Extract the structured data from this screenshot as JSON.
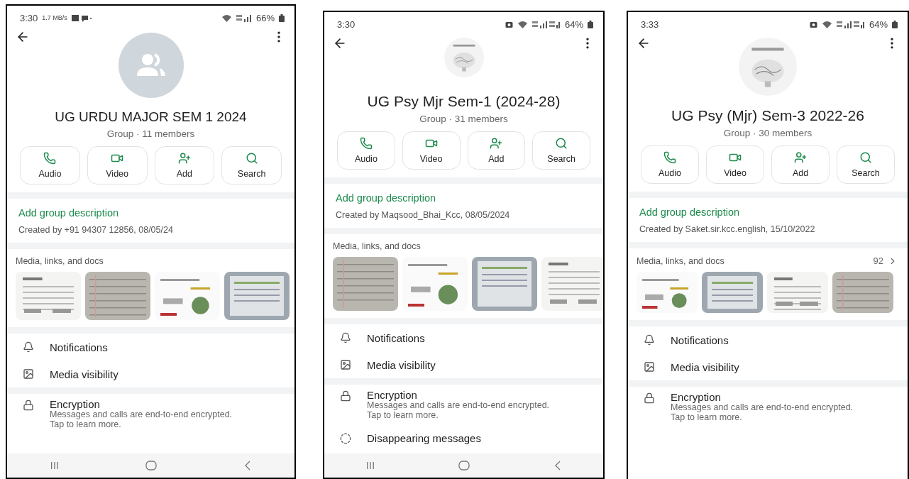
{
  "phones": [
    {
      "status_bar": {
        "time": "3:30",
        "net_speed": "1.7 MB/s",
        "battery": "66%"
      },
      "avatar": {
        "kind": "group-icon"
      },
      "name": "UG URDU MAJOR SEM 1 2024",
      "subtitle": "Group · 11 members",
      "actions": [
        {
          "kind": "audio",
          "label": "Audio"
        },
        {
          "kind": "video",
          "label": "Video"
        },
        {
          "kind": "add",
          "label": "Add"
        },
        {
          "kind": "search",
          "label": "Search"
        }
      ],
      "description_link": "Add group description",
      "created": "Created by +91 94307 12856, 08/05/24",
      "media": {
        "title": "Media, links, and docs",
        "thumbnails": [
          {
            "kind": "picture"
          },
          {
            "kind": "picture"
          },
          {
            "kind": "picture"
          },
          {
            "kind": "picture"
          }
        ]
      },
      "settings": [
        {
          "kind": "notifications",
          "title": "Notifications"
        },
        {
          "kind": "media",
          "title": "Media visibility"
        },
        {
          "kind": "encryption",
          "title": "Encryption",
          "subtitle": "Messages and calls are end-to-end encrypted. Tap to learn more."
        }
      ],
      "nav_bar": true
    },
    {
      "status_bar": {
        "time": "3:30",
        "battery": "64%"
      },
      "avatar": {
        "kind": "picture"
      },
      "name": "UG Psy Mjr Sem-1 (2024-28)",
      "subtitle": "Group · 31 members",
      "actions": [
        {
          "kind": "audio",
          "label": "Audio"
        },
        {
          "kind": "video",
          "label": "Video"
        },
        {
          "kind": "add",
          "label": "Add"
        },
        {
          "kind": "search",
          "label": "Search"
        }
      ],
      "description_link": "Add group description",
      "created": "Created by Maqsood_Bhai_Kcc, 08/05/2024",
      "media": {
        "title": "Media, links, and docs",
        "thumbnails": [
          {
            "kind": "picture"
          },
          {
            "kind": "picture"
          },
          {
            "kind": "picture"
          },
          {
            "kind": "picture"
          }
        ]
      },
      "settings": [
        {
          "kind": "notifications",
          "title": "Notifications"
        },
        {
          "kind": "media",
          "title": "Media visibility"
        },
        {
          "kind": "encryption",
          "title": "Encryption",
          "subtitle": "Messages and calls are end-to-end encrypted. Tap to learn more."
        },
        {
          "kind": "disappearing",
          "title": "Disappearing messages"
        }
      ],
      "nav_bar": true
    },
    {
      "status_bar": {
        "time": "3:33",
        "battery": "64%"
      },
      "avatar": {
        "kind": "picture"
      },
      "name": "UG Psy (Mjr) Sem-3 2022-26",
      "subtitle": "Group · 30 members",
      "actions": [
        {
          "kind": "audio",
          "label": "Audio"
        },
        {
          "kind": "video",
          "label": "Video"
        },
        {
          "kind": "add",
          "label": "Add"
        },
        {
          "kind": "search",
          "label": "Search"
        }
      ],
      "description_link": "Add group description",
      "created": "Created by Saket.sir.kcc.english, 15/10/2022",
      "media": {
        "title": "Media, links, and docs",
        "count": "92",
        "thumbnails": [
          {
            "kind": "picture"
          },
          {
            "kind": "picture"
          },
          {
            "kind": "picture"
          },
          {
            "kind": "picture"
          }
        ]
      },
      "settings": [
        {
          "kind": "notifications",
          "title": "Notifications"
        },
        {
          "kind": "media",
          "title": "Media visibility"
        },
        {
          "kind": "encryption",
          "title": "Encryption",
          "subtitle": "Messages and calls are end-to-end encrypted. Tap to learn more."
        }
      ],
      "nav_bar": false
    }
  ]
}
